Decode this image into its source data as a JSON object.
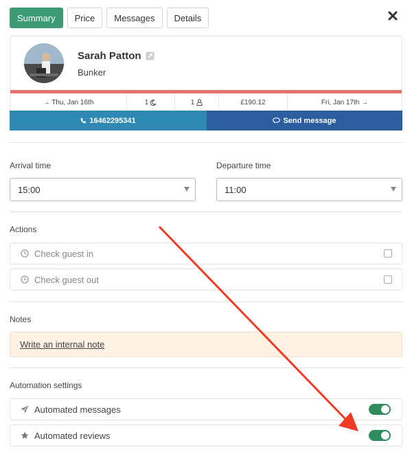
{
  "tabs": [
    {
      "label": "Summary",
      "active": true
    },
    {
      "label": "Price",
      "active": false
    },
    {
      "label": "Messages",
      "active": false
    },
    {
      "label": "Details",
      "active": false
    }
  ],
  "close_icon": "close-icon",
  "guest": {
    "name": "Sarah Patton",
    "room": "Bunker"
  },
  "stats": {
    "arrival": "→ Thu, Jan 16th",
    "nights": "1",
    "guests": "1",
    "price": "£190.12",
    "departure": "Fri, Jan 17th →"
  },
  "contact": {
    "phone": "16462295341",
    "send_message": "Send message"
  },
  "times": {
    "arrival_label": "Arrival time",
    "arrival_value": "15:00",
    "departure_label": "Departure time",
    "departure_value": "11:00"
  },
  "actions": {
    "label": "Actions",
    "items": [
      "Check guest in",
      "Check guest out"
    ]
  },
  "notes": {
    "label": "Notes",
    "link": "Write an internal note"
  },
  "automation": {
    "label": "Automation settings",
    "items": [
      {
        "label": "Automated messages",
        "icon": "paper-plane-icon",
        "enabled": true
      },
      {
        "label": "Automated reviews",
        "icon": "star-icon",
        "enabled": true
      }
    ]
  },
  "colors": {
    "primary_green": "#3c9a75",
    "toggle_green": "#2f8c5c",
    "phone_blue": "#2e8ab3",
    "message_blue": "#2c5d9f",
    "status_red": "#e4726d",
    "note_bg": "#fdf2e3",
    "annotation_arrow": "#f03a22"
  }
}
